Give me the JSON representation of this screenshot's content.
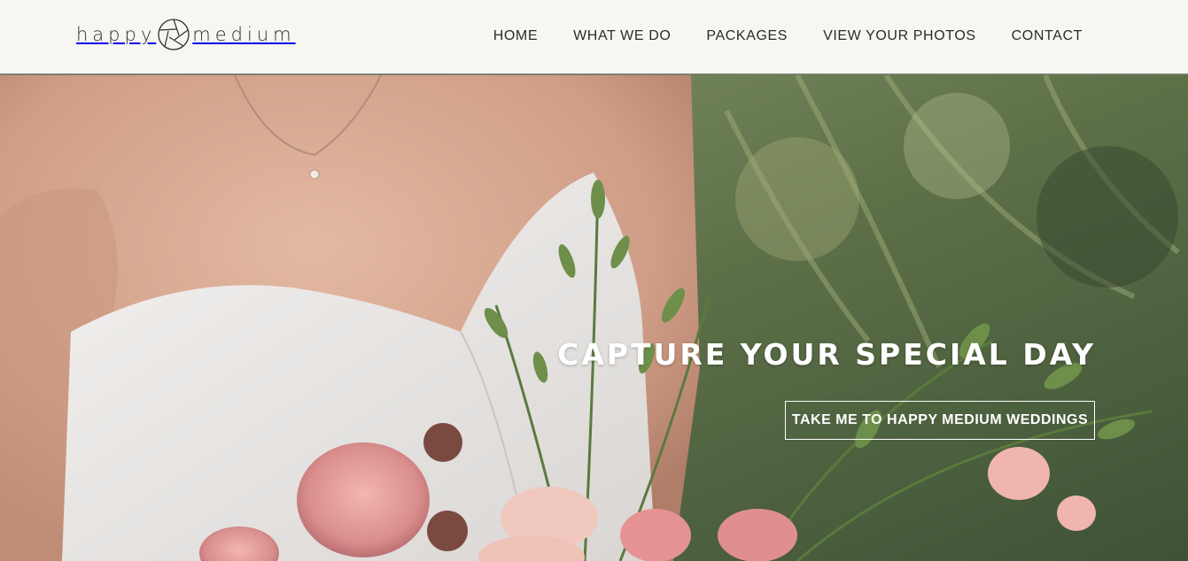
{
  "brand": {
    "word_left": "happy",
    "word_right": "medium",
    "logo_icon": "aperture-icon"
  },
  "nav": {
    "items": [
      {
        "label": "HOME"
      },
      {
        "label": "WHAT WE DO"
      },
      {
        "label": "PACKAGES"
      },
      {
        "label": "VIEW YOUR PHOTOS"
      },
      {
        "label": "CONTACT"
      }
    ]
  },
  "hero": {
    "title": "CAPTURE YOUR SPECIAL DAY",
    "cta_label": "TAKE ME TO HAPPY MEDIUM WEDDINGS",
    "image_subject": "bride with peony and eucalyptus bouquet"
  },
  "colors": {
    "header_bg": "#fcfbf9",
    "nav_text": "#2b2b2b",
    "hero_text": "#ffffff"
  }
}
